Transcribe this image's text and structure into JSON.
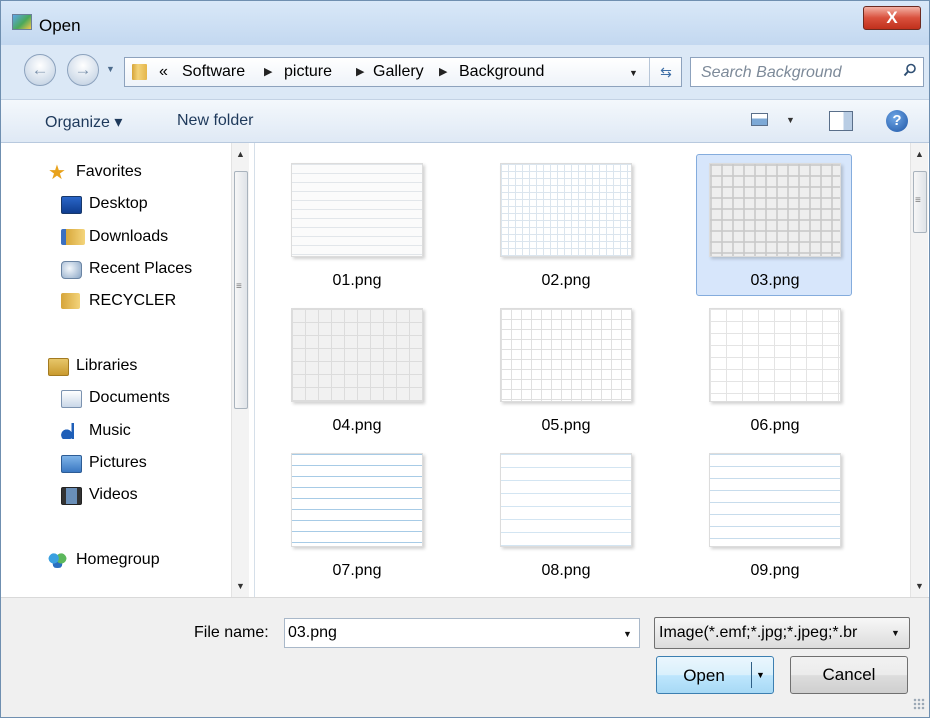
{
  "window": {
    "title": "Open",
    "close_glyph": "X"
  },
  "address": {
    "crumbs": [
      "«",
      "Software",
      "picture",
      "Gallery",
      "Background"
    ],
    "search_placeholder": "Search Background"
  },
  "toolbar": {
    "organize_label": "Organize ▾",
    "new_folder_label": "New folder",
    "help_glyph": "?"
  },
  "nav": {
    "favorites": {
      "label": "Favorites",
      "icon": "star-icon"
    },
    "favorite_items": [
      {
        "label": "Desktop",
        "icon": "desktop-icon"
      },
      {
        "label": "Downloads",
        "icon": "downloads-icon"
      },
      {
        "label": "Recent Places",
        "icon": "recent-places-icon"
      },
      {
        "label": "RECYCLER",
        "icon": "folder-icon"
      }
    ],
    "libraries": {
      "label": "Libraries",
      "icon": "libraries-icon"
    },
    "library_items": [
      {
        "label": "Documents",
        "icon": "documents-icon"
      },
      {
        "label": "Music",
        "icon": "music-icon"
      },
      {
        "label": "Pictures",
        "icon": "pictures-icon"
      },
      {
        "label": "Videos",
        "icon": "videos-icon"
      }
    ],
    "homegroup": {
      "label": "Homegroup",
      "icon": "homegroup-icon"
    }
  },
  "files": [
    {
      "name": "01.png",
      "selected": false
    },
    {
      "name": "02.png",
      "selected": false
    },
    {
      "name": "03.png",
      "selected": true
    },
    {
      "name": "04.png",
      "selected": false
    },
    {
      "name": "05.png",
      "selected": false
    },
    {
      "name": "06.png",
      "selected": false
    },
    {
      "name": "07.png",
      "selected": false
    },
    {
      "name": "08.png",
      "selected": false
    },
    {
      "name": "09.png",
      "selected": false
    }
  ],
  "footer": {
    "file_name_label": "File name:",
    "file_name_value": "03.png",
    "file_type": "Image(*.emf;*.jpg;*.jpeg;*.br",
    "open_label": "Open",
    "cancel_label": "Cancel"
  },
  "colors": {
    "selection": "#d7e6fb",
    "selection_border": "#84acdd",
    "window_frame": "#dbe8f6",
    "close_red": "#c0301c"
  }
}
